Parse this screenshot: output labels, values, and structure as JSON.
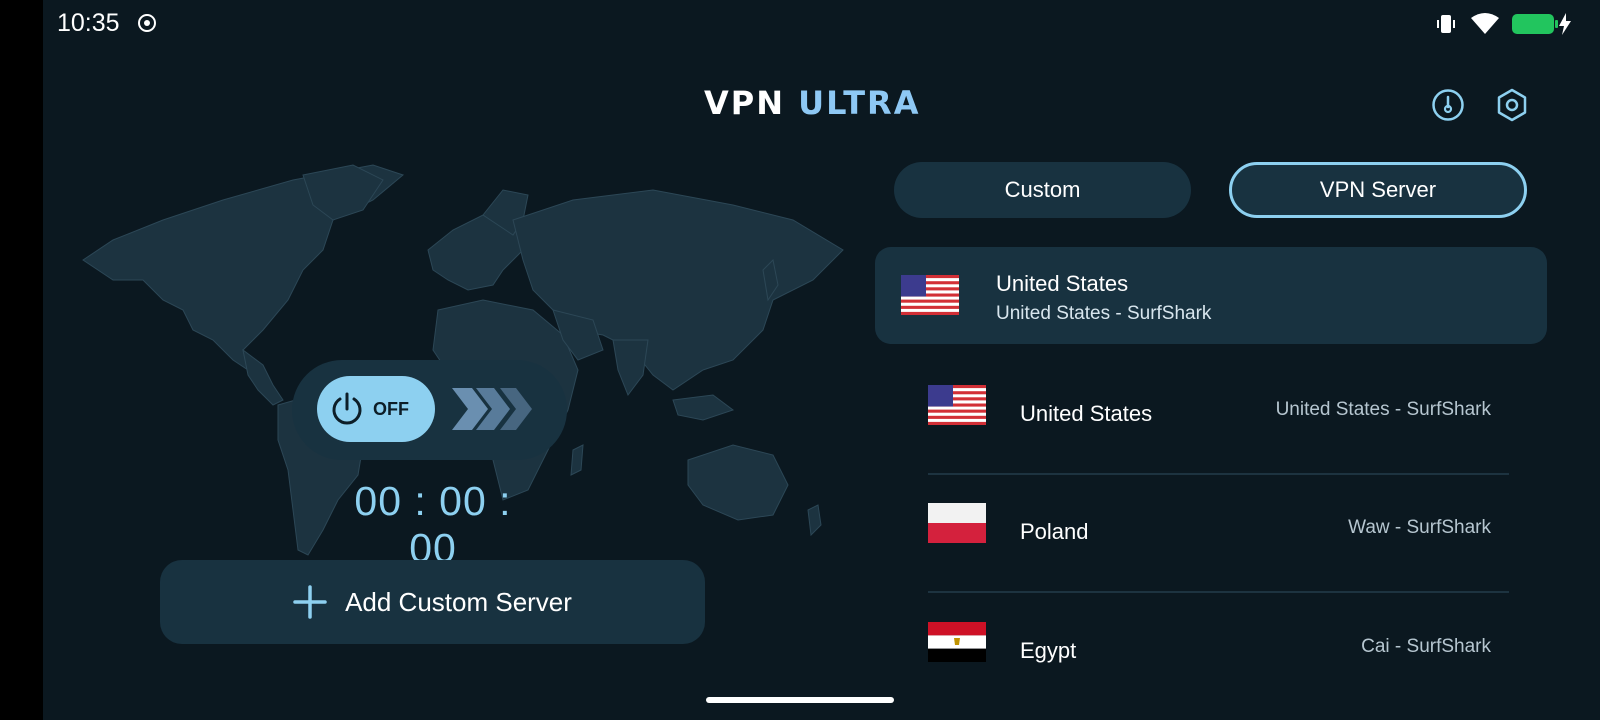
{
  "status": {
    "time": "10:35",
    "battery_color": "#22c55e",
    "icons": [
      "record-icon",
      "vibrate-icon",
      "wifi-icon",
      "battery-icon"
    ]
  },
  "header": {
    "title_part1": "VPN",
    "title_part2": "ULTRA",
    "title_color_1": "#ffffff",
    "title_color_2": "#8ec8f4",
    "icons": [
      "speedometer-icon",
      "settings-icon"
    ]
  },
  "connection": {
    "state_label": "OFF",
    "timer": "00 : 00 : 00",
    "accent": "#8dd0f0"
  },
  "add_server": {
    "label": "Add Custom Server"
  },
  "tabs": [
    {
      "label": "Custom",
      "active": false
    },
    {
      "label": "VPN Server",
      "active": true
    }
  ],
  "selected_server": {
    "country": "United States",
    "detail": "United States - SurfShark",
    "flag": "us-flag"
  },
  "servers": [
    {
      "country": "United States",
      "location": "United States - SurfShark",
      "flag": "us-flag"
    },
    {
      "country": "Poland",
      "location": "Waw - SurfShark",
      "flag": "poland-flag"
    },
    {
      "country": "Egypt",
      "location": "Cai - SurfShark",
      "flag": "egypt-flag"
    }
  ]
}
